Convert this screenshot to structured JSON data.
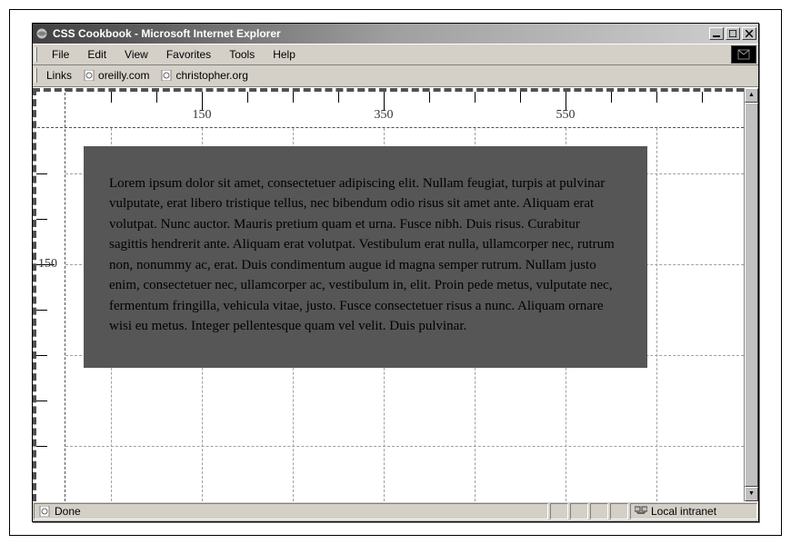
{
  "window": {
    "title": "CSS Cookbook - Microsoft Internet Explorer"
  },
  "menu": {
    "items": [
      "File",
      "Edit",
      "View",
      "Favorites",
      "Tools",
      "Help"
    ]
  },
  "linksbar": {
    "label": "Links",
    "favorites": [
      "oreilly.com",
      "christopher.org"
    ]
  },
  "ruler": {
    "h_labels": [
      {
        "pos": 150,
        "text": "150"
      },
      {
        "pos": 350,
        "text": "350"
      },
      {
        "pos": 550,
        "text": "550"
      }
    ],
    "v_labels": [
      {
        "pos": 150,
        "text": "150"
      }
    ]
  },
  "content": {
    "body_text": "Lorem ipsum dolor sit amet, consectetuer adipiscing elit. Nullam feugiat, turpis at pulvinar vulputate, erat libero tristique tellus, nec bibendum odio risus sit amet ante. Aliquam erat volutpat. Nunc auctor. Mauris pretium quam et urna. Fusce nibh. Duis risus. Curabitur sagittis hendrerit ante. Aliquam erat volutpat. Vestibulum erat nulla, ullamcorper nec, rutrum non, nonummy ac, erat. Duis condimentum augue id magna semper rutrum. Nullam justo enim, consectetuer nec, ullamcorper ac, vestibulum in, elit. Proin pede metus, vulputate nec, fermentum fringilla, vehicula vitae, justo. Fusce consectetuer risus a nunc. Aliquam ornare wisi eu metus. Integer pellentesque quam vel velit. Duis pulvinar."
  },
  "status": {
    "left": "Done",
    "zone": "Local intranet"
  }
}
